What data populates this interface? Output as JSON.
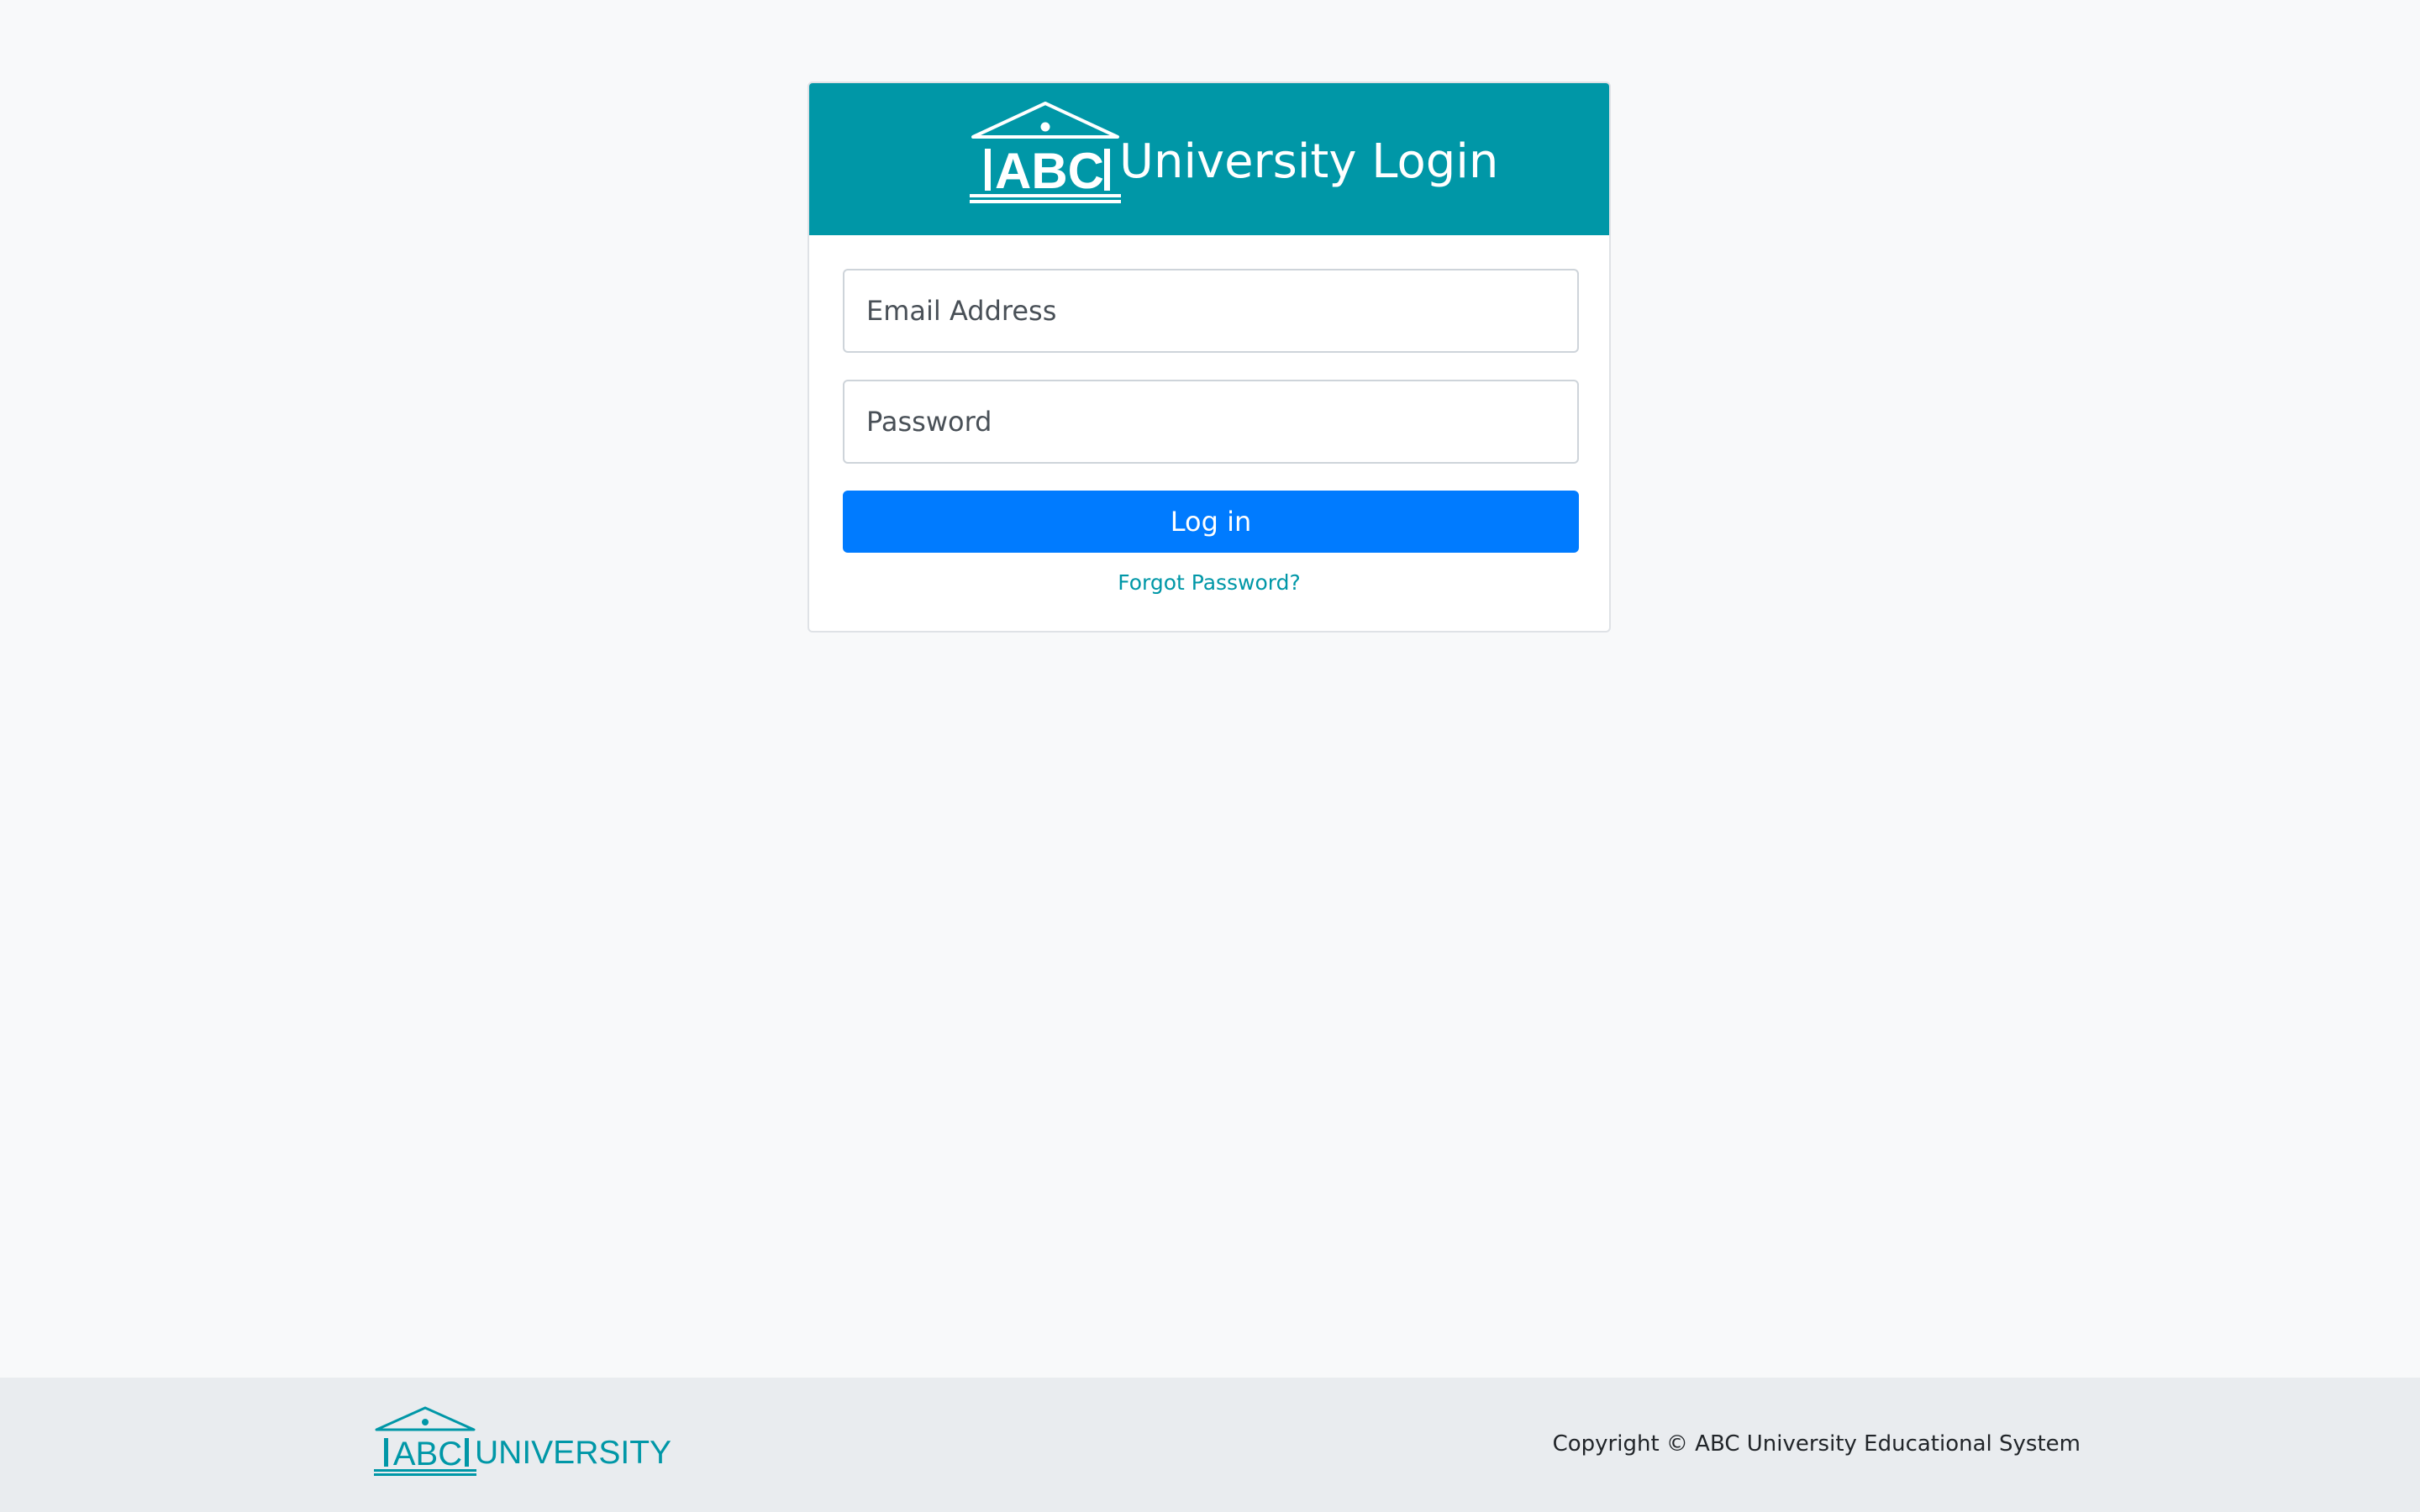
{
  "header": {
    "logo_text": "ABC",
    "title": "University Login",
    "background": "#0097a7"
  },
  "form": {
    "email_placeholder": "Email Address",
    "password_placeholder": "Password",
    "login_label": "Log in",
    "login_color": "#007bff",
    "forgot_label": "Forgot Password?"
  },
  "footer": {
    "logo_text": "ABC",
    "brand": "UNIVERSITY",
    "copyright": "Copyright © ABC University Educational System"
  },
  "icons": {
    "header_logo": "university-building-logo-icon",
    "footer_logo": "university-building-logo-icon"
  }
}
